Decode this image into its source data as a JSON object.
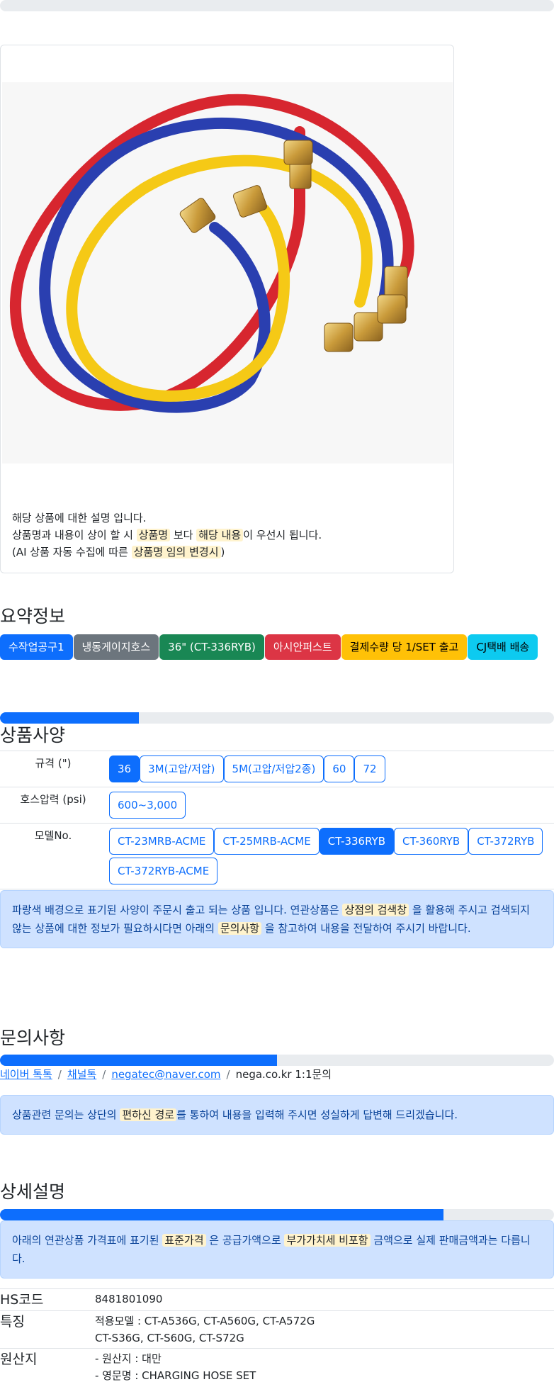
{
  "top_progress_fill_pct": 0,
  "product": {
    "image_alt": "냉동게이지호스 이미지",
    "notes": {
      "line1": "해당 상품에 대한 설명 입니다.",
      "line2_a": "상품명과 내용이 상이 할 시",
      "line2_hl1": "상품명",
      "line2_b": "보다",
      "line2_hl2": "해당 내용",
      "line2_c": "이 우선시 됩니다.",
      "line3_a": "(AI 상품 자동 수집에 따른",
      "line3_hl": "상품명 임의 변경시",
      "line3_b": ")"
    }
  },
  "summary": {
    "title": "요약정보",
    "badges": [
      {
        "label": "수작업공구1",
        "color": "#0d6efd",
        "text_color": "#ffffff"
      },
      {
        "label": "냉동게이지호스",
        "color": "#6c757d",
        "text_color": "#ffffff"
      },
      {
        "label": "36\" (CT-336RYB)",
        "color": "#198754",
        "text_color": "#ffffff"
      },
      {
        "label": "아시안퍼스트",
        "color": "#dc3545",
        "text_color": "#ffffff"
      },
      {
        "label": "결제수량 당 1/SET 출고",
        "color": "#ffc107",
        "text_color": "#000000"
      },
      {
        "label": "CJ택배 배송",
        "color": "#0dcaf0",
        "text_color": "#000000"
      }
    ]
  },
  "spec": {
    "progress_pct": 25,
    "title": "상품사양",
    "rows": [
      {
        "label": "규격 (\")",
        "options": [
          {
            "text": "36",
            "active": true
          },
          {
            "text": "3M(고압/저압)",
            "active": false
          },
          {
            "text": "5M(고압/저압2종)",
            "active": false
          },
          {
            "text": "60",
            "active": false
          },
          {
            "text": "72",
            "active": false
          }
        ]
      },
      {
        "label": "호스압력 (psi)",
        "options": [
          {
            "text": "600~3,000",
            "active": false
          }
        ]
      },
      {
        "label": "모델No.",
        "options": [
          {
            "text": "CT-23MRB-ACME",
            "active": false
          },
          {
            "text": "CT-25MRB-ACME",
            "active": false
          },
          {
            "text": "CT-336RYB",
            "active": true
          },
          {
            "text": "CT-360RYB",
            "active": false
          },
          {
            "text": "CT-372RYB",
            "active": false
          },
          {
            "text": "CT-372RYB-ACME",
            "active": false
          }
        ]
      }
    ],
    "alert": {
      "a": "파랑색 배경으로 표기된 사양이 주문시 출고 되는 상품 입니다. 연관상품은",
      "hl1": "상점의 검색창",
      "b": "을 활용해 주시고 검색되지 않는 상품에 대한 정보가 필요하시다면 아래의",
      "hl2": "문의사항",
      "c": "을 참고하여 내용을 전달하여 주시기 바랍니다."
    }
  },
  "inquiry": {
    "title": "문의사항",
    "progress_pct": 50,
    "links": [
      "네이버 톡톡",
      "채널톡",
      "negatec@naver.com"
    ],
    "plain": "nega.co.kr 1:1문의",
    "alert": {
      "a": "상품관련 문의는 상단의",
      "hl": "편하신 경로",
      "b": "를 통하여 내용을 입력해 주시면 성실하게 답변해 드리겠습니다."
    }
  },
  "detail": {
    "title": "상세설명",
    "progress_pct": 80,
    "alert": {
      "a": "아래의 연관상품 가격표에 표기된",
      "hl1": "표준가격",
      "b": "은 공급가액으로",
      "hl2": "부가가치세 비포함",
      "c": "금액으로 실제 판매금액과는 다릅니다."
    },
    "rows": [
      {
        "key": "HS코드",
        "lines": [
          "8481801090"
        ]
      },
      {
        "key": "특징",
        "lines": [
          "적용모델 : CT-A536G, CT-A560G, CT-A572G",
          "CT-S36G, CT-S60G, CT-S72G"
        ]
      },
      {
        "key": "원산지",
        "lines": [
          "- 원산지 : 대만",
          "- 영문명 : CHARGING HOSE SET"
        ]
      }
    ]
  }
}
